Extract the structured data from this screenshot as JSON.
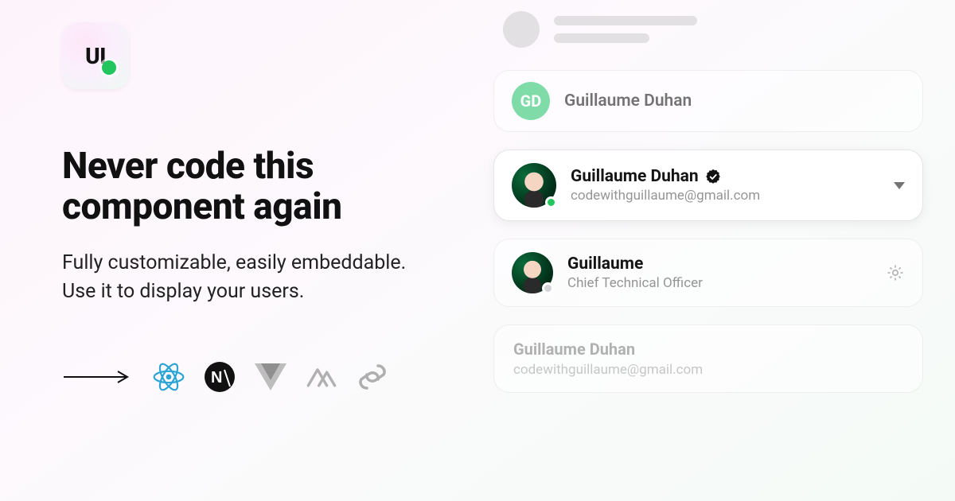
{
  "logo": {
    "text": "UI"
  },
  "headline": "Never code this component again",
  "subtitle": "Fully customizable, easily embeddable. Use it to display your users.",
  "tech": [
    "react",
    "next",
    "vue",
    "nuxt",
    "svelte"
  ],
  "cards": {
    "initials": {
      "avatar_initials": "GD",
      "name": "Guillaume Duhan"
    },
    "verified": {
      "name": "Guillaume Duhan",
      "email": "codewithguillaume@gmail.com",
      "status": "online"
    },
    "role": {
      "name": "Guillaume",
      "role": "Chief Technical Officer",
      "status": "offline"
    },
    "text_only": {
      "name": "Guillaume Duhan",
      "email": "codewithguillaume@gmail.com"
    }
  }
}
